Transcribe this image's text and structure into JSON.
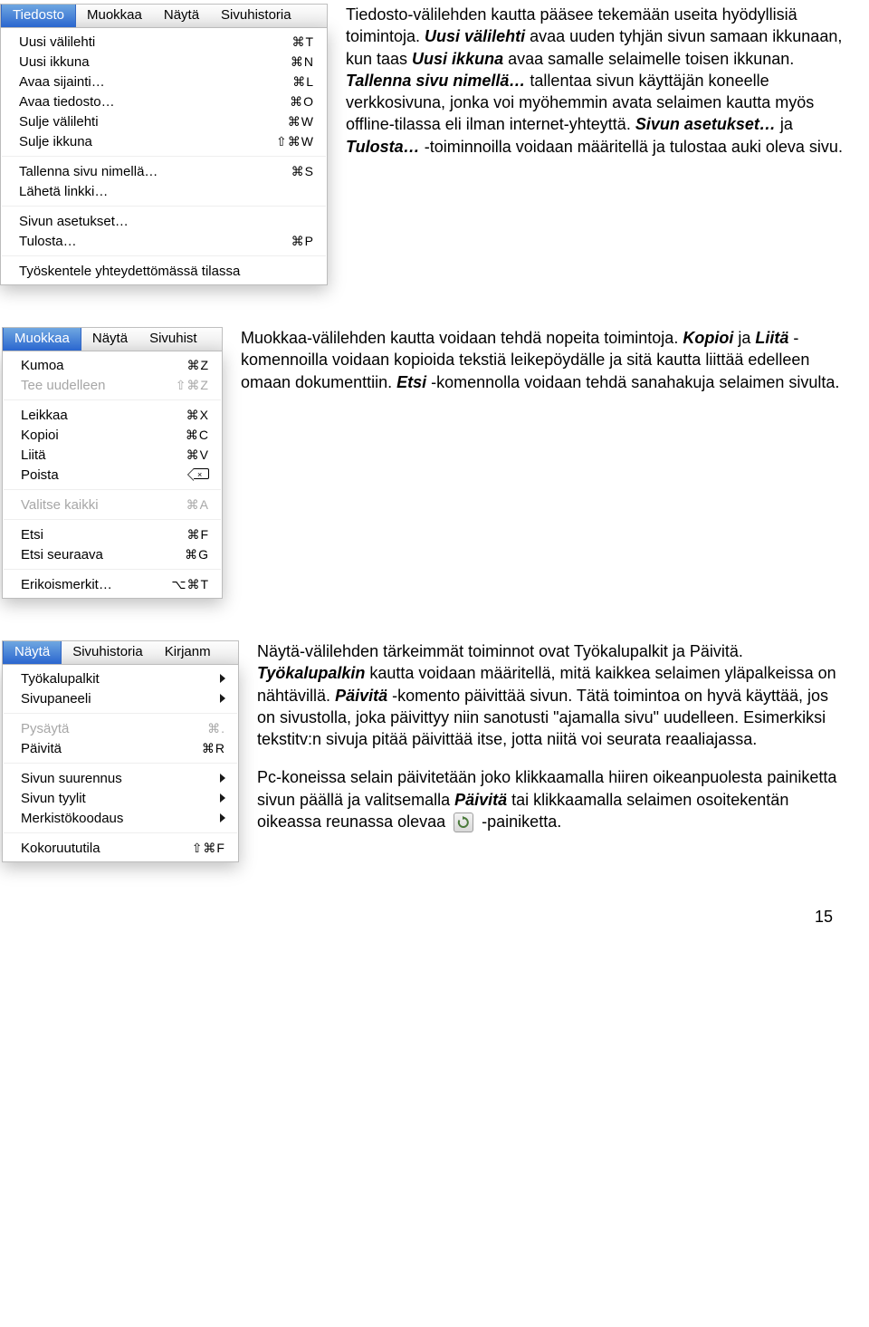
{
  "tiedosto": {
    "menubar": [
      "Tiedosto",
      "Muokkaa",
      "Näytä",
      "Sivuhistoria"
    ],
    "active": 0,
    "items": [
      {
        "label": "Uusi välilehti",
        "shortcut": "⌘T"
      },
      {
        "label": "Uusi ikkuna",
        "shortcut": "⌘N"
      },
      {
        "label": "Avaa sijainti…",
        "shortcut": "⌘L"
      },
      {
        "label": "Avaa tiedosto…",
        "shortcut": "⌘O"
      },
      {
        "label": "Sulje välilehti",
        "shortcut": "⌘W"
      },
      {
        "label": "Sulje ikkuna",
        "shortcut": "⇧⌘W"
      },
      {
        "sep": true
      },
      {
        "label": "Tallenna sivu nimellä…",
        "shortcut": "⌘S"
      },
      {
        "label": "Lähetä linkki…",
        "shortcut": ""
      },
      {
        "sep": true
      },
      {
        "label": "Sivun asetukset…",
        "shortcut": ""
      },
      {
        "label": "Tulosta…",
        "shortcut": "⌘P"
      },
      {
        "sep": true
      },
      {
        "label": "Työskentele yhteydettömässä tilassa",
        "shortcut": ""
      }
    ]
  },
  "muokkaa": {
    "menubar": [
      "Muokkaa",
      "Näytä",
      "Sivuhist"
    ],
    "active": 0,
    "items": [
      {
        "label": "Kumoa",
        "shortcut": "⌘Z"
      },
      {
        "label": "Tee uudelleen",
        "shortcut": "⇧⌘Z",
        "disabled": true
      },
      {
        "sep": true
      },
      {
        "label": "Leikkaa",
        "shortcut": "⌘X"
      },
      {
        "label": "Kopioi",
        "shortcut": "⌘C"
      },
      {
        "label": "Liitä",
        "shortcut": "⌘V"
      },
      {
        "label": "Poista",
        "shortcut": "BACKSPACE_ICON"
      },
      {
        "sep": true
      },
      {
        "label": "Valitse kaikki",
        "shortcut": "⌘A",
        "disabled": true
      },
      {
        "sep": true
      },
      {
        "label": "Etsi",
        "shortcut": "⌘F"
      },
      {
        "label": "Etsi seuraava",
        "shortcut": "⌘G"
      },
      {
        "sep": true
      },
      {
        "label": "Erikoismerkit…",
        "shortcut": "⌥⌘T"
      }
    ]
  },
  "nayta": {
    "menubar": [
      "Näytä",
      "Sivuhistoria",
      "Kirjanm"
    ],
    "active": 0,
    "items": [
      {
        "label": "Työkalupalkit",
        "submenu": true
      },
      {
        "label": "Sivupaneeli",
        "submenu": true
      },
      {
        "sep": true
      },
      {
        "label": "Pysäytä",
        "shortcut": "⌘.",
        "disabled": true
      },
      {
        "label": "Päivitä",
        "shortcut": "⌘R"
      },
      {
        "sep": true
      },
      {
        "label": "Sivun suurennus",
        "submenu": true
      },
      {
        "label": "Sivun tyylit",
        "submenu": true
      },
      {
        "label": "Merkistökoodaus",
        "submenu": true
      },
      {
        "sep": true
      },
      {
        "label": "Kokoruututila",
        "shortcut": "⇧⌘F"
      }
    ]
  },
  "desc": {
    "tiedosto": {
      "t1": "Tiedosto-välilehden kautta pääsee tekemään useita hyödyllisiä toimintoja. ",
      "bi1": "Uusi välilehti",
      "t2": " avaa uuden tyhjän sivun samaan ikkunaan, kun taas ",
      "bi2": "Uusi ikkuna",
      "t3": " avaa samalle selaimelle toisen ikkunan. ",
      "bi3": "Tallenna sivu nimellä…",
      "t4": " tallentaa sivun käyttäjän koneelle verkkosivuna, jonka voi myöhemmin avata selaimen kautta myös offline-tilassa eli ilman internet-yhteyttä. ",
      "bi4": "Sivun asetukset…",
      "t5": " ja ",
      "bi5": "Tulosta…",
      "t6": " -toiminnoilla voidaan määritellä ja tulostaa auki oleva sivu."
    },
    "muokkaa": {
      "t1": "Muokkaa-välilehden kautta voidaan tehdä nopeita toimintoja. ",
      "bi1": "Kopioi",
      "t2": " ja ",
      "bi2": "Liitä",
      "t3": " -komennoilla voidaan kopioida tekstiä leikepöydälle ja sitä kautta liittää edelleen omaan dokumenttiin. ",
      "bi3": "Etsi",
      "t4": "-komennolla voidaan tehdä sanahakuja selaimen sivulta."
    },
    "nayta": {
      "t1": "Näytä-välilehden tärkeimmät toiminnot ovat Työkalupalkit ja Päivitä. ",
      "bi1": "Työkalupalkin",
      "t2": " kautta voidaan määritellä, mitä kaikkea selaimen yläpalkeissa on nähtävillä. ",
      "bi2": "Päivitä",
      "t3": "-komento päivittää sivun. Tätä toimintoa on hyvä käyttää, jos on sivustolla, joka päivittyy niin sanotusti \"ajamalla sivu\" uudelleen. Esimerkiksi tekstitv:n sivuja pitää päivittää itse, jotta niitä voi seurata reaaliajassa.",
      "p2a": "Pc-koneissa selain päivitetään joko klikkaamalla hiiren oikeanpuolesta painiketta sivun päällä ja valitsemalla ",
      "bi3": "Päivitä",
      "p2b": " tai klikkaamalla selaimen osoitekentän oikeassa reunassa olevaa ",
      "p2c": " -painiketta."
    }
  },
  "page_number": "15"
}
